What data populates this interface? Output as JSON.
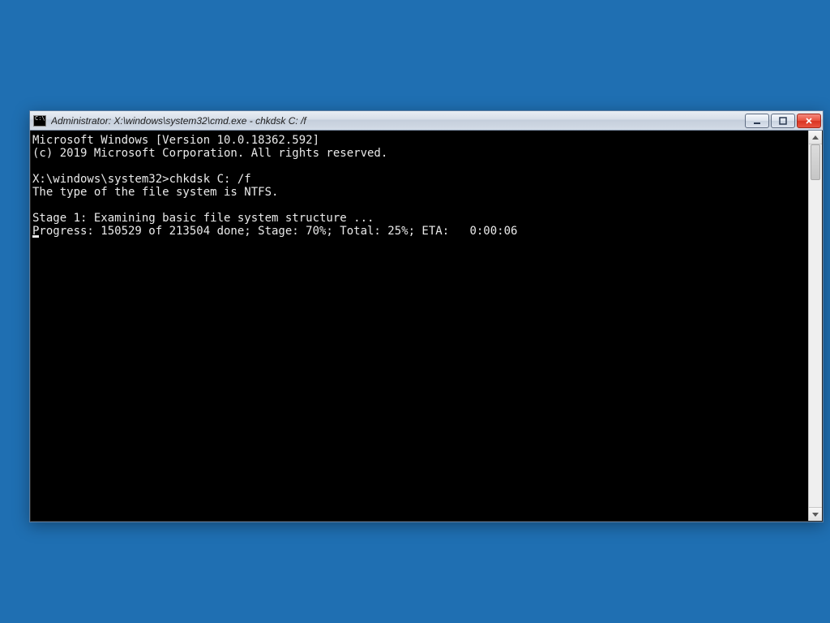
{
  "window": {
    "title": "Administrator: X:\\windows\\system32\\cmd.exe - chkdsk  C: /f"
  },
  "terminal": {
    "lines": [
      "Microsoft Windows [Version 10.0.18362.592]",
      "(c) 2019 Microsoft Corporation. All rights reserved.",
      "",
      "X:\\windows\\system32>chkdsk C: /f",
      "The type of the file system is NTFS.",
      "",
      "Stage 1: Examining basic file system structure ...",
      "Progress: 150529 of 213504 done; Stage: 70%; Total: 25%; ETA:   0:00:06"
    ]
  }
}
